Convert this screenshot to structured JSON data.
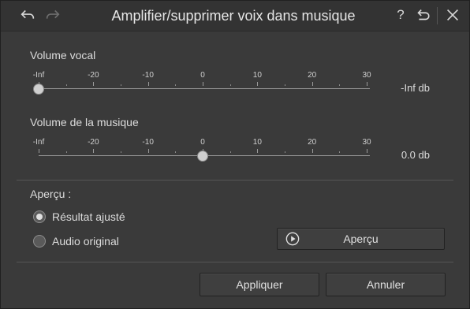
{
  "window": {
    "title": "Amplifier/supprimer voix dans musique",
    "help_glyph": "?",
    "icons": [
      "undo-icon",
      "redo-icon",
      "help-icon",
      "reset-icon",
      "close-icon"
    ]
  },
  "vocal": {
    "label": "Volume vocal",
    "ticks": [
      "-Inf",
      "-20",
      "-10",
      "0",
      "10",
      "20",
      "30"
    ],
    "value_text": "-Inf db",
    "position_fraction": 0.0
  },
  "music": {
    "label": "Volume de la musique",
    "ticks": [
      "-Inf",
      "-20",
      "-10",
      "0",
      "10",
      "20",
      "30"
    ],
    "value_text": "0.0 db",
    "position_fraction": 0.5
  },
  "preview": {
    "label": "Aperçu :",
    "options": [
      {
        "label": "Résultat ajusté",
        "selected": true
      },
      {
        "label": "Audio original",
        "selected": false
      }
    ],
    "button_label": "Aperçu"
  },
  "footer": {
    "apply_label": "Appliquer",
    "cancel_label": "Annuler"
  }
}
